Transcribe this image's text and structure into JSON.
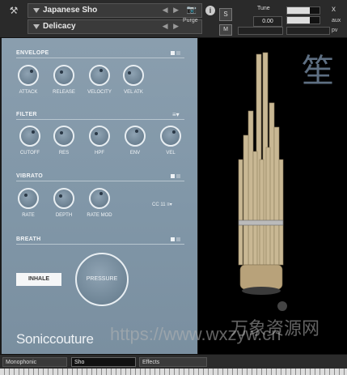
{
  "header": {
    "instrument_name": "Japanese Sho",
    "preset_name": "Delicacy",
    "purge_label": "Purge",
    "s_label": "S",
    "m_label": "M",
    "tune_label": "Tune",
    "tune_value": "0.00",
    "aux_label": "aux",
    "pv_label": "pv",
    "close_glyph": "x",
    "info_glyph": "i",
    "camera_glyph": "📷",
    "nav_arrows": "◀ ▶"
  },
  "envelope": {
    "title": "ENVELOPE",
    "knobs": [
      {
        "label": "ATTACK"
      },
      {
        "label": "RELEASE"
      },
      {
        "label": "VELOCITY"
      },
      {
        "label": "VEL ATK"
      }
    ]
  },
  "filter": {
    "title": "FILTER",
    "menu_glyph": "≡▾",
    "knobs": [
      {
        "label": "CUTOFF"
      },
      {
        "label": "RES"
      },
      {
        "label": "HPF"
      },
      {
        "label": "ENV"
      },
      {
        "label": "VEL"
      }
    ]
  },
  "vibrato": {
    "title": "VIBRATO",
    "cc_label": "CC 11",
    "menu_glyph": "≡▾",
    "knobs": [
      {
        "label": "RATE"
      },
      {
        "label": "DEPTH"
      },
      {
        "label": "RATE MOD"
      }
    ]
  },
  "breath": {
    "title": "BREATH",
    "inhale_label": "INHALE",
    "pressure_label": "PRESSURE"
  },
  "brand": {
    "logo": "Soniccouture"
  },
  "image": {
    "kanji": "笙"
  },
  "footer": {
    "tabs": [
      {
        "label": "Monophonic"
      },
      {
        "label": "Sho"
      },
      {
        "label": "Effects"
      }
    ]
  },
  "watermark": {
    "url": "https://www.wxzyw.cn",
    "cn": "万象资源网"
  },
  "colors": {
    "panel": "#8197a8",
    "accent": "#eef2f5",
    "image_bg": "#000000"
  }
}
